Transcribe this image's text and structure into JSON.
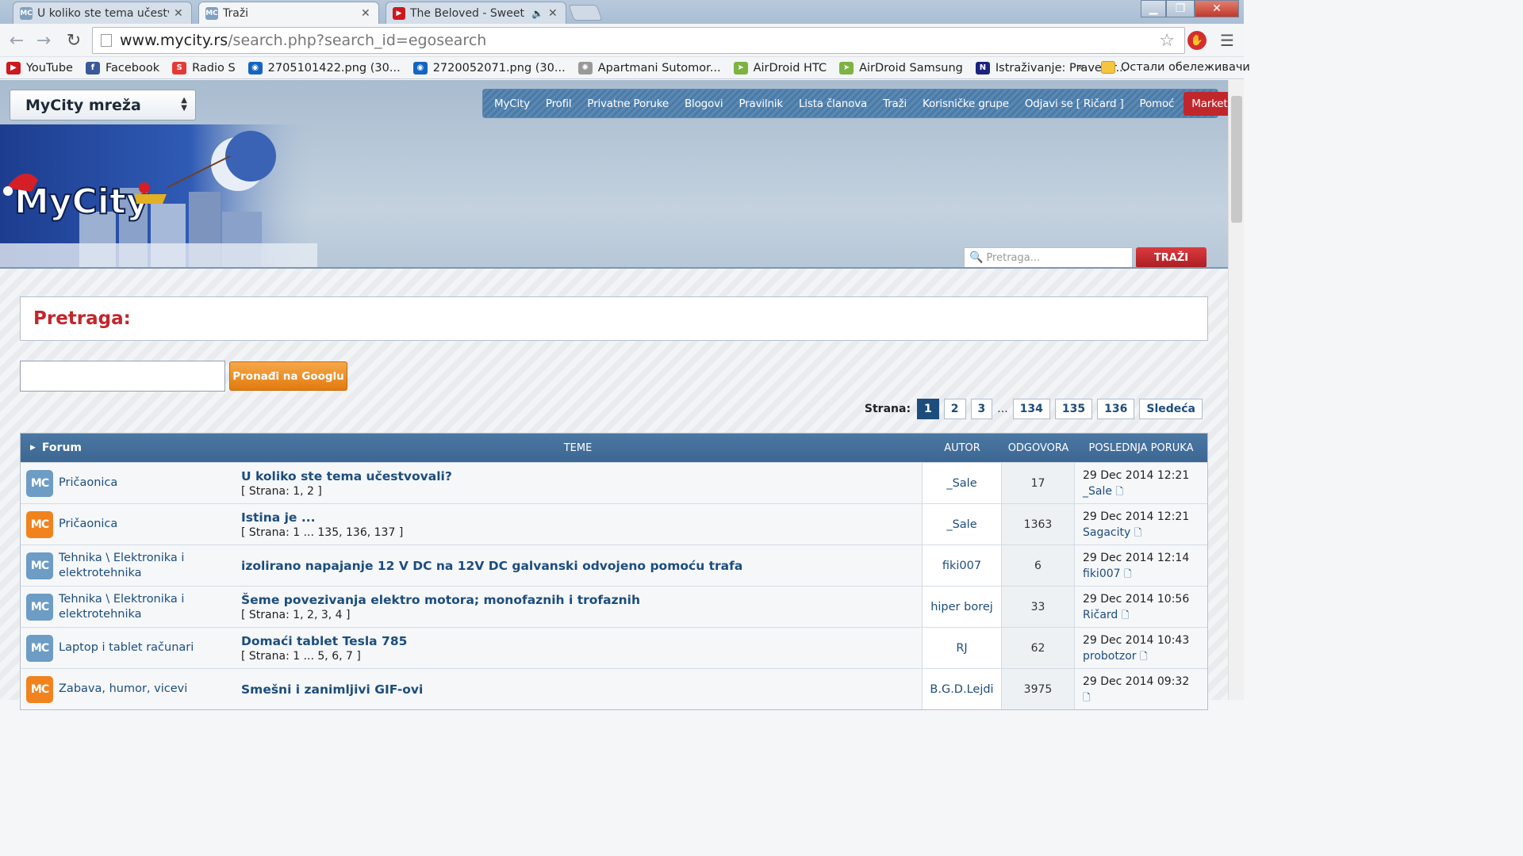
{
  "browser": {
    "tabs": [
      {
        "title": "U koliko ste tema učestvovali?"
      },
      {
        "title": "Traži"
      },
      {
        "title": "The Beloved - Sweet Harmony"
      }
    ],
    "url_main": "www.mycity.rs",
    "url_rest": "/search.php?search_id=egosearch",
    "bookmarks": [
      {
        "label": "YouTube",
        "icon": "youtube-icon",
        "color": "#cc181e"
      },
      {
        "label": "Facebook",
        "icon": "facebook-icon",
        "color": "#3b5998"
      },
      {
        "label": "Radio S",
        "icon": "radio-s-icon",
        "color": "#e53935"
      },
      {
        "label": "2705101422.png (30...",
        "icon": "image-icon",
        "color": "#1565c0"
      },
      {
        "label": "2720052071.png (30...",
        "icon": "image-icon",
        "color": "#1565c0"
      },
      {
        "label": "Apartmani Sutomor...",
        "icon": "globe-icon",
        "color": "#888888"
      },
      {
        "label": "AirDroid HTC",
        "icon": "airdroid-icon",
        "color": "#7cb342"
      },
      {
        "label": "AirDroid Samsung",
        "icon": "airdroid-icon",
        "color": "#7cb342"
      },
      {
        "label": "Istraživanje: Prave kr...",
        "icon": "ni-icon",
        "color": "#1a237e"
      }
    ],
    "bookmarks_overflow": "»",
    "other_bookmarks": "Остали обележивачи"
  },
  "site": {
    "selector_label": "MyCity mreža",
    "nav": [
      "MyCity",
      "Profil",
      "Privatne Poruke",
      "Blogovi",
      "Pravilnik",
      "Lista članova",
      "Traži",
      "Korisničke grupe",
      "Odjavi se [ Ričard ]",
      "Pomoć",
      "Marketing"
    ],
    "search_placeholder": "Pretraga...",
    "search_button": "TRAŽI"
  },
  "main": {
    "heading": "Pretraga:",
    "google_button": "Pronađi na Googlu",
    "pager": {
      "label": "Strana:",
      "pages": [
        "1",
        "2",
        "3",
        "134",
        "135",
        "136"
      ],
      "current": "1",
      "ellipsis": "...",
      "next": "Sledeća"
    },
    "table": {
      "headers": {
        "forum": "Forum",
        "topics": "TEME",
        "author": "AUTOR",
        "replies": "ODGOVORA",
        "last": "POSLEDNJA PORUKA"
      },
      "rows": [
        {
          "icon_color": "#6d9cc4",
          "forum": "Pričaonica",
          "topic": "U koliko ste tema učestvovali?",
          "pages": "[ Strana: 1, 2 ]",
          "author": "_Sale",
          "replies": "17",
          "date": "29 Dec 2014 12:21",
          "last_user": "_Sale"
        },
        {
          "icon_color": "#f0831e",
          "forum": "Pričaonica",
          "topic": "Istina je ...",
          "pages": "[ Strana: 1 ... 135, 136, 137 ]",
          "author": "_Sale",
          "replies": "1363",
          "date": "29 Dec 2014 12:21",
          "last_user": "Sagacity"
        },
        {
          "icon_color": "#6d9cc4",
          "forum": "Tehnika \\ Elektronika i elektrotehnika",
          "topic": "izolirano napajanje 12 V DC na 12V DC galvanski odvojeno pomoću trafa",
          "pages": "",
          "author": "fiki007",
          "replies": "6",
          "date": "29 Dec 2014 12:14",
          "last_user": "fiki007"
        },
        {
          "icon_color": "#6d9cc4",
          "forum": "Tehnika \\ Elektronika i elektrotehnika",
          "topic": "Šeme povezivanja elektro motora; monofaznih i trofaznih",
          "pages": "[ Strana: 1, 2, 3, 4 ]",
          "author": "hiper borej",
          "replies": "33",
          "date": "29 Dec 2014 10:56",
          "last_user": "Ričard"
        },
        {
          "icon_color": "#6d9cc4",
          "forum": "Laptop i tablet računari",
          "topic": "Domaći tablet Tesla 785",
          "pages": "[ Strana: 1 ... 5, 6, 7 ]",
          "author": "RJ",
          "replies": "62",
          "date": "29 Dec 2014 10:43",
          "last_user": "probotzor"
        },
        {
          "icon_color": "#f0831e",
          "forum": "Zabava, humor, vicevi",
          "topic": "Smešni i zanimljivi GIF-ovi",
          "pages": "",
          "author": "B.G.D.Lejdi",
          "replies": "3975",
          "date": "29 Dec 2014 09:32",
          "last_user": ""
        }
      ]
    }
  }
}
